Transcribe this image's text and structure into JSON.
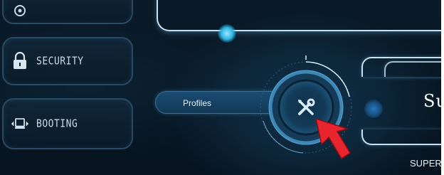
{
  "sidebar": {
    "items": [
      {
        "label": "SECURITY",
        "icon": "padlock-icon"
      },
      {
        "label": "BOOTING",
        "icon": "drive-switch-icon"
      }
    ]
  },
  "main": {
    "profiles_label": "Profiles",
    "dial_icon": "tools-icon",
    "title_partial": "Su",
    "subtitle_partial": "SUPER"
  },
  "colors": {
    "accent": "#2bb4e3",
    "frame": "#c7e3f3",
    "pill": "#1a4b72",
    "cursor": "#e8252f"
  }
}
